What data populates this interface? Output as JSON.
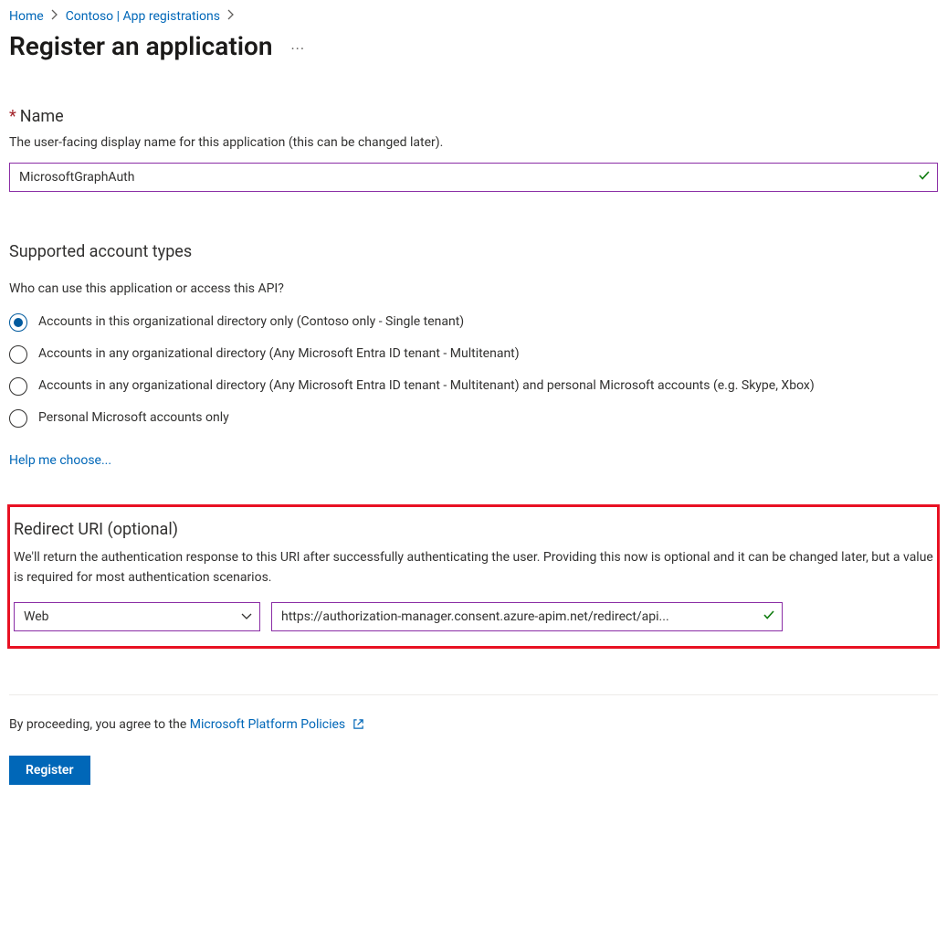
{
  "breadcrumb": {
    "items": [
      {
        "label": "Home"
      },
      {
        "label": "Contoso | App registrations"
      }
    ]
  },
  "page": {
    "title": "Register an application"
  },
  "name_section": {
    "label": "Name",
    "description": "The user-facing display name for this application (this can be changed later).",
    "value": "MicrosoftGraphAuth"
  },
  "account_types": {
    "heading": "Supported account types",
    "question": "Who can use this application or access this API?",
    "options": [
      {
        "label": "Accounts in this organizational directory only (Contoso only - Single tenant)",
        "selected": true
      },
      {
        "label": "Accounts in any organizational directory (Any Microsoft Entra ID tenant - Multitenant)",
        "selected": false
      },
      {
        "label": "Accounts in any organizational directory (Any Microsoft Entra ID tenant - Multitenant) and personal Microsoft accounts (e.g. Skype, Xbox)",
        "selected": false
      },
      {
        "label": "Personal Microsoft accounts only",
        "selected": false
      }
    ],
    "help_link": "Help me choose..."
  },
  "redirect": {
    "heading": "Redirect URI (optional)",
    "description": "We'll return the authentication response to this URI after successfully authenticating the user. Providing this now is optional and it can be changed later, but a value is required for most authentication scenarios.",
    "platform": "Web",
    "uri": "https://authorization-manager.consent.azure-apim.net/redirect/api..."
  },
  "footer": {
    "policies_prefix": "By proceeding, you agree to the ",
    "policies_link": "Microsoft Platform Policies",
    "register_label": "Register"
  }
}
